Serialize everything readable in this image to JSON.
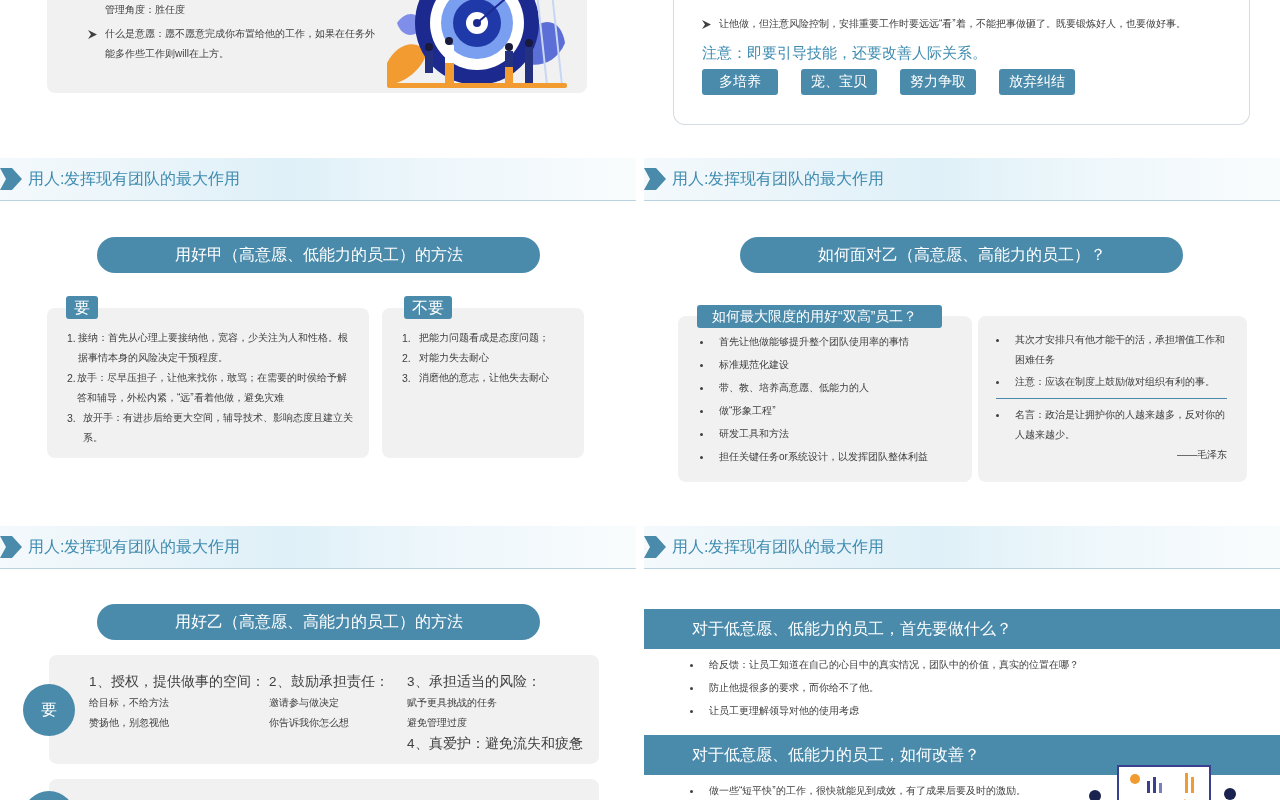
{
  "slides": [
    {
      "kind": "card_with_picture",
      "lines": [
        {
          "text": "管理角度：胜任度",
          "bullet": false
        },
        {
          "text": "什么是意愿：愿不愿意完成你布置给他的工作，如果在任务外能多作些工作则will在上方。",
          "bullet": true
        }
      ],
      "picture": {
        "kind": "picture"
      }
    },
    {
      "kind": "framed_notes",
      "bullets": [
        "让他做，但注意风险控制，安排重要工作时要远远“看”着，不能把事做砸了。既要锻炼好人，也要做好事。"
      ],
      "note": "注意：即要引导技能，还要改善人际关系。",
      "buttons": [
        "多培养",
        "宠、宝贝",
        "努力争取",
        "放弃纠结"
      ]
    },
    {
      "kind": "do_dont",
      "header": "用人:发挥现有团队的最大作用",
      "title": "用好甲（高意愿、低能力的员工）的方法",
      "panels": [
        {
          "tag": "要",
          "items": [
            {
              "num": "1.",
              "text": "接纳：首先从心理上要接纳他，宽容，少关注为人和性格。根据事情本身的风险决定干预程度。"
            },
            {
              "num": "2.",
              "text": "放手：尽早压担子，让他来找你，敢骂；在需要的时侯给予解答和辅导，外松内紧，“远”看着他做，避免灾难"
            },
            {
              "num": "3.",
              "text": "放开手：有进步后给更大空间，辅导技术、影响态度且建立关系。"
            }
          ]
        },
        {
          "tag": "不要",
          "items": [
            {
              "num": "1.",
              "text": "把能力问题看成是态度问题；"
            },
            {
              "num": "2.",
              "text": "对能力失去耐心"
            },
            {
              "num": "3.",
              "text": "消磨他的意志，让他失去耐心"
            }
          ]
        }
      ]
    },
    {
      "kind": "qa_cards",
      "header": "用人:发挥现有团队的最大作用",
      "title": "如何面对乙（高意愿、高能力的员工）？",
      "left": {
        "tab": "如何最大限度的用好“双高”员工？",
        "items": [
          "首先让他做能够提升整个团队使用率的事情",
          "标准规范化建设",
          "带、教、培养高意愿、低能力的人",
          "做“形象工程”",
          "研发工具和方法",
          "担任关键任务or系统设计，以发挥团队整体利益"
        ]
      },
      "right": {
        "items": [
          "其次才安排只有他才能干的活，承担增值工作和困难任务",
          "注意：应该在制度上鼓励做对组织有利的事。"
        ],
        "quote": "名言：政治是让拥护你的人越来越多，反对你的人越来越少。",
        "attribution": "——毛泽东"
      }
    },
    {
      "kind": "do_columns",
      "header": "用人:发挥现有团队的最大作用",
      "title": "用好乙（高意愿、高能力的员工）的方法",
      "tag": "要",
      "columns": [
        {
          "groups": [
            {
              "heading": "1、授权，提供做事的空间：",
              "items": [
                "给目标，不给方法",
                "赞扬他，别忽视他"
              ]
            }
          ]
        },
        {
          "groups": [
            {
              "heading": "2、鼓励承担责任：",
              "items": [
                "邀请参与做决定",
                "你告诉我你怎么想"
              ]
            }
          ]
        },
        {
          "groups": [
            {
              "heading": "3、承担适当的风险：",
              "items": [
                "赋予更具挑战的任务",
                "避免管理过度"
              ]
            },
            {
              "heading": "4、真爱护：避免流失和疲惫"
            }
          ]
        }
      ]
    },
    {
      "kind": "question_bands",
      "header": "用人:发挥现有团队的最大作用",
      "sections": [
        {
          "heading": "对于低意愿、低能力的员工，首先要做什么？",
          "items": [
            "给反馈：让员工知道在自己的心目中的真实情况，团队中的价值，真实的位置在哪？",
            "防止他提很多的要求，而你给不了他。",
            "让员工更理解领导对他的使用考虑"
          ]
        },
        {
          "heading": "对于低意愿、低能力的员工，如何改善？",
          "items": [
            "做一些“短平快”的工作，很快就能见到成效，有了成果后要及时的激励。"
          ]
        }
      ]
    }
  ]
}
